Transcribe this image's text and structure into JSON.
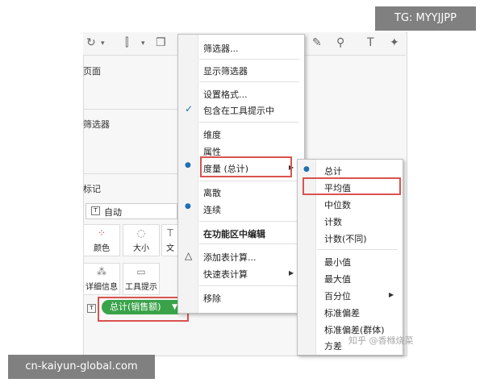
{
  "watermark": {
    "tg": "TG: MYYJJPP",
    "site": "cn-kaiyun-global.com",
    "zhihu": "知乎 @香橼烧菜"
  },
  "left_pane": {
    "pages": "页面",
    "filters": "筛选器",
    "marks": "标记",
    "auto": "自动",
    "mark_buttons": [
      "颜色",
      "大小",
      "文",
      "详细信息",
      "工具提示"
    ],
    "pill": "总计(销售额)"
  },
  "menu": {
    "items": [
      "筛选器...",
      "显示筛选器",
      "设置格式...",
      "包含在工具提示中",
      "维度",
      "属性",
      "度量 (总计)",
      "离散",
      "连续",
      "在功能区中编辑",
      "添加表计算...",
      "快速表计算",
      "移除"
    ],
    "check_mark": "✓",
    "bullet": "●",
    "triangle": "△",
    "arrow": "▶"
  },
  "submenu": {
    "items": [
      "总计",
      "平均值",
      "中位数",
      "计数",
      "计数(不同)",
      "最小值",
      "最大值",
      "百分位",
      "标准偏差",
      "标准偏差(群体)",
      "方差"
    ]
  },
  "colors": {
    "pill": "#3aa34a",
    "highlight": "#d9534f",
    "check": "#1f6fb2"
  }
}
